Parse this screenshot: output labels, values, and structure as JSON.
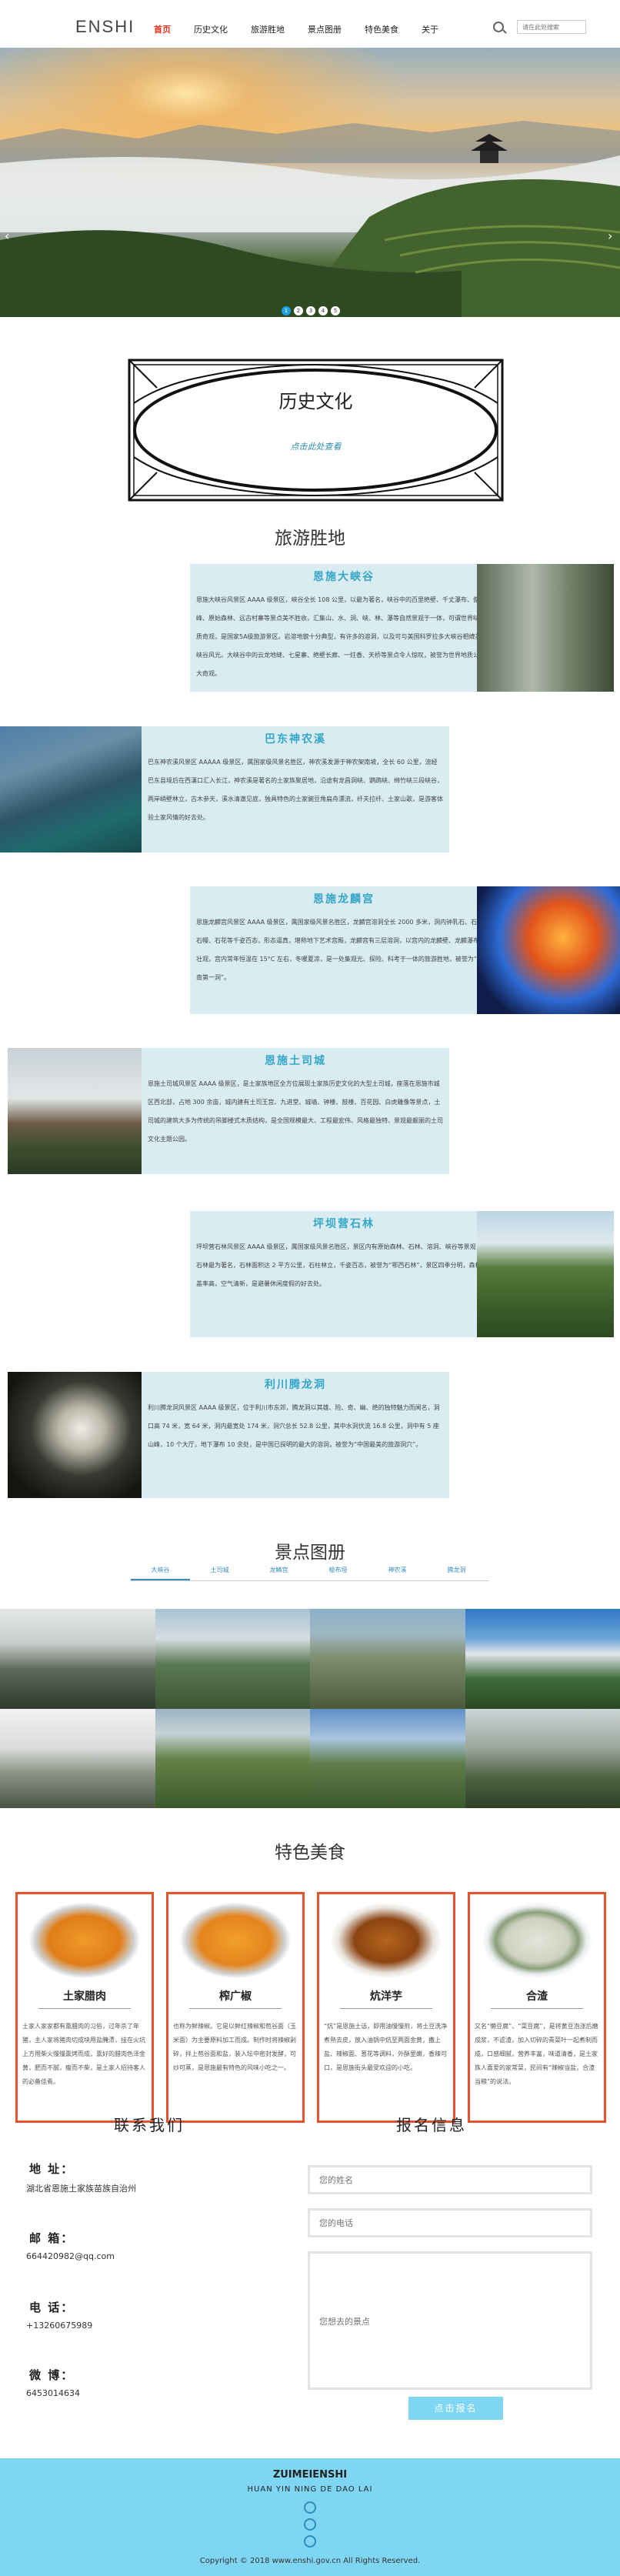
{
  "nav": {
    "logo": "ENSHI",
    "items": [
      "首页",
      "历史文化",
      "旅游胜地",
      "景点图册",
      "特色美食",
      "关于"
    ],
    "search_placeholder": "请在此处搜索"
  },
  "banner": {
    "slides": [
      "1",
      "2",
      "3",
      "4",
      "5"
    ],
    "prev": "‹",
    "next": "›"
  },
  "history": {
    "title": "历史文化",
    "link": "点击此处查看"
  },
  "spots": {
    "title": "旅游胜地",
    "items": [
      {
        "name": "恩施大峡谷",
        "desc": "恩施大峡谷风景区 AAAA 级景区，峡谷全长 108 公里，以最为著名，峡谷中的百里绝壁、千丈瀑布、傲啸独峰、原始森林、远古村寨等景点美不胜收，汇集山、水、洞、峡、林、瀑等自然景观于一体，可谓世界峡谷地质奇观，是国家5A级旅游景区。岩溶地貌十分典型，有许多的溶洞，以及可与美国科罗拉多大峡谷相媲美的峡谷风光。大峡谷中的云龙地缝、七星寨、绝壁长廊、一炷香、天桥等景点令人惊叹，被誉为世界地质公园一大奇观。"
      },
      {
        "name": "巴东神农溪",
        "desc": "巴东神农溪风景区 AAAAA 级景区，属国家级风景名胜区，神农溪发源于神农架南坡，全长 60 公里，流经巴东县境后在西瀼口汇入长江，神农溪是著名的土家族聚居地，沿途有龙昌洞峡、鹦鹉峡、绵竹峡三段峡谷，两岸峭壁林立，古木参天，溪水清澈见底，独具特色的土家豌豆角扁舟漂流，纤夫拉纤、土家山歌，是游客体验土家风情的好去处。"
      },
      {
        "name": "恩施龙麟宫",
        "desc": "恩施龙麟宫风景区 AAAA 级景区，属国家级风景名胜区，龙麟宫溶洞全长 2000 多米，洞内钟乳石、石笋、石幔、石花等千姿百态，形态逼真，堪称地下艺术宫殿，龙麟宫有三层溶洞，以宫内的龙麟壁、龙麟瀑布最为壮观，宫内常年恒温在 15°C 左右，冬暖夏凉，是一处集观光、探险、科考于一体的旅游胜地，被誉为“鄂西南第一洞”。"
      },
      {
        "name": "恩施土司城",
        "desc": "恩施土司城风景区 AAAA 级景区，是土家族地区全方位展现土家族历史文化的大型土司城，座落在恩施市城区西北部，占地 300 余亩，城内建有土司王宫、九进堂、城墙、钟楼、鼓楼、百花园、白虎雕像等景点，土司城的建筑大多为传统的吊脚楼式木质结构，是全国规模最大、工程最宏伟、风格最独特、景观最靓丽的土司文化主题公园。"
      },
      {
        "name": "坪坝营石林",
        "desc": "坪坝营石林风景区 AAAA 级景区，属国家级风景名胜区，景区内有原始森林、石林、溶洞、峡谷等景观，以石林最为著名，石林面积达 2 平方公里，石柱林立，千姿百态，被誉为“鄂西石林”，景区四季分明，森林覆盖率高，空气清新，是避暑休闲度假的好去处。"
      },
      {
        "name": "利川腾龙洞",
        "desc": "利川腾龙洞风景区 AAAA 级景区，位于利川市东郊，腾龙洞以其雄、险、奇、幽、绝的独特魅力而闻名，洞口高 74 米，宽 64 米，洞内最宽处 174 米，洞穴总长 52.8 公里，其中水洞伏流 16.8 公里，洞中有 5 座山峰，10 个大厅，地下瀑布 10 余处，是中国已探明的最大的溶洞，被誉为“中国最美的旅游洞穴”。"
      }
    ]
  },
  "gallery": {
    "title": "景点图册",
    "tabs": [
      "大峡谷",
      "土司城",
      "龙鳞宫",
      "梭布垭",
      "神农溪",
      "腾龙洞"
    ]
  },
  "food": {
    "title": "特色美食",
    "items": [
      {
        "name": "土家腊肉",
        "desc": "土家人家家都有熏腊肉的习俗，过年杀了年猪，主人家将猪肉切成块用盐腌渍，挂在火坑上方用柴火慢慢熏烤而成，熏好的腊肉色泽金黄，肥而不腻，瘦而不柴，是土家人招待客人的必备佳肴。"
      },
      {
        "name": "榨广椒",
        "desc": "也称为鲜辣椒。它是以鲜红辣椒和苞谷面（玉米面）为主要原料加工而成。制作时将辣椒剁碎，拌上苞谷面和盐，装入坛中密封发酵，可炒可蒸，是恩施最有特色的风味小吃之一。"
      },
      {
        "name": "炕洋芋",
        "desc": "“炕”是恩施土话，即用油慢慢煎，将土豆洗净煮熟去皮，放入油锅中炕至两面金黄，撒上盐、辣椒面、葱花等调料，外酥里嫩，香辣可口，是恩施街头最受欢迎的小吃。"
      },
      {
        "name": "合渣",
        "desc": "又名“懒豆腐”、“菜豆腐”，是将黄豆泡涨后磨成浆，不滤渣，加入切碎的青菜叶一起煮制而成，口感细腻，营养丰富，味道清香，是土家族人喜爱的家常菜，民间有“辣椒当盐，合渣当粮”的说法。"
      }
    ]
  },
  "contact": {
    "title": "联系我们",
    "address_label": "地 址：",
    "address": "湖北省恩施土家族苗族自治州",
    "email_label": "邮 箱：",
    "email": "664420982@qq.com",
    "phone_label": "电 话：",
    "phone": "+13260675989",
    "weibo_label": "微 博：",
    "weibo": "6453014634"
  },
  "signup": {
    "title": "报名信息",
    "name_placeholder": "您的姓名",
    "phone_placeholder": "您的电话",
    "message_placeholder": "您想去的景点",
    "submit": "点击报名"
  },
  "footer": {
    "brand": "ZUIMEIENSHI",
    "slogan": "HUAN YIN NING DE DAO LAI",
    "copyright": "Copyright © 2018 www.enshi.gov.cn All Rights Reserved."
  },
  "colors": {
    "accent": "#e8321c",
    "spot_bg": "#d8ecf2",
    "title_blue": "#36a6c8",
    "footer_bg": "#7fd6f2",
    "food_border": "#e2542c"
  }
}
